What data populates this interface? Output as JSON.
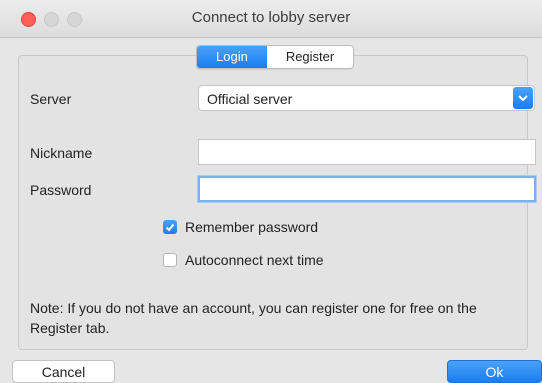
{
  "window": {
    "title": "Connect to lobby server"
  },
  "tabs": [
    {
      "label": "Login",
      "active": true
    },
    {
      "label": "Register",
      "active": false
    }
  ],
  "form": {
    "server_label": "Server",
    "server_value": "Official server",
    "nickname_label": "Nickname",
    "nickname_value": "",
    "password_label": "Password",
    "password_value": ""
  },
  "options": {
    "remember_label": "Remember password",
    "remember_checked": true,
    "autoconnect_label": "Autoconnect next time",
    "autoconnect_checked": false
  },
  "note": "Note: If you do not have an account, you can register one for free on the Register tab.",
  "buttons": {
    "cancel": "Cancel",
    "ok": "Ok"
  },
  "colors": {
    "accent": "#1a7ef0",
    "close": "#fc5f57"
  },
  "icons": {
    "close": "traffic-close-icon",
    "minimize": "traffic-minimize-icon",
    "maximize": "traffic-maximize-icon",
    "dropdown": "chevron-down-icon",
    "check": "checkmark-icon"
  }
}
